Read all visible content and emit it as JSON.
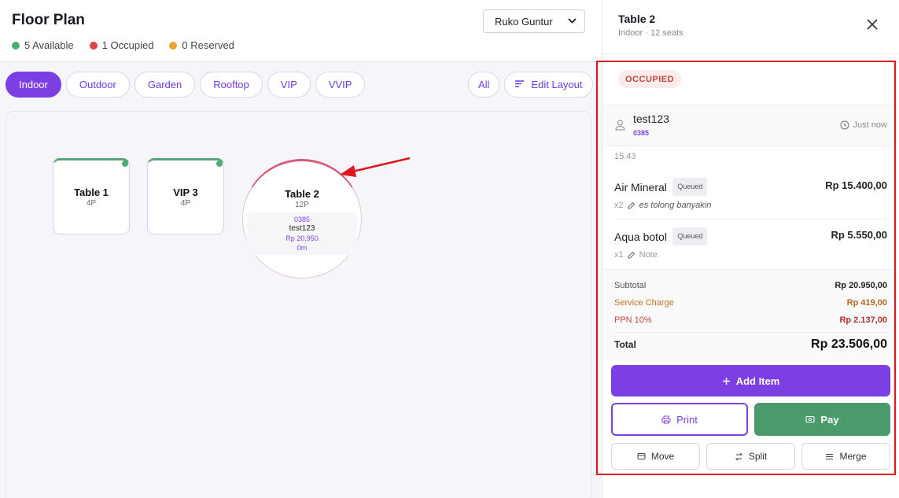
{
  "floor": {
    "title": "Floor Plan",
    "branch": "Ruko Guntur",
    "legend": [
      {
        "label": "5 Available",
        "color": "#4cae72"
      },
      {
        "label": "1 Occupied",
        "color": "#e0434a"
      },
      {
        "label": "0 Reserved",
        "color": "#f0a030"
      }
    ],
    "zones": [
      "Indoor",
      "Outdoor",
      "Garden",
      "Rooftop",
      "VIP",
      "VVIP"
    ],
    "active_zone": "Indoor",
    "filter_all": "All",
    "edit_layout": "Edit Layout",
    "tables": [
      {
        "name": "Table 1",
        "capacity": "4P"
      },
      {
        "name": "VIP 3",
        "capacity": "4P"
      }
    ],
    "occupied_table": {
      "name": "Table 2",
      "capacity": "12P",
      "order_code": "0385",
      "customer": "test123",
      "amount": "Rp 20.950",
      "duration": "0m"
    }
  },
  "panel": {
    "title": "Table 2",
    "subtitle": "Indoor · 12 seats",
    "status": "OCCUPIED",
    "customer": {
      "name": "test123",
      "code": "0385",
      "time": "Just now"
    },
    "order_time": "15.43",
    "items": [
      {
        "name": "Air Mineral",
        "status": "Queued",
        "price": "Rp 15.400,00",
        "qty": "x2",
        "note": "es tolong banyakin"
      },
      {
        "name": "Aqua botol",
        "status": "Queued",
        "price": "Rp 5.550,00",
        "qty": "x1",
        "note": "Note"
      }
    ],
    "summary": {
      "subtotal_label": "Subtotal",
      "subtotal": "Rp 20.950,00",
      "service_label": "Service Charge",
      "service": "Rp 419,00",
      "ppn_label": "PPN 10%",
      "ppn": "Rp 2.137,00",
      "total_label": "Total",
      "total": "Rp 23.506,00"
    },
    "actions": {
      "add_item": "Add Item",
      "print": "Print",
      "pay": "Pay",
      "move": "Move",
      "split": "Split",
      "merge": "Merge"
    }
  },
  "colors": {
    "accent": "#7c3fe4",
    "pay": "#4b9a6c",
    "occupied": "#c2453e",
    "highlight": "#e0161c"
  }
}
